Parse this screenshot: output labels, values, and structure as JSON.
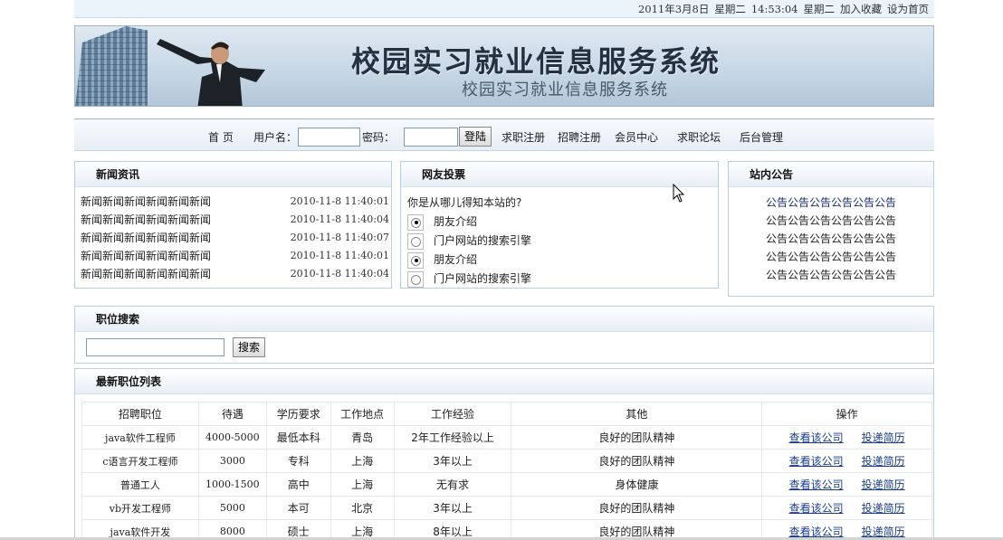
{
  "topbar": {
    "date": "2011年3月8日",
    "weekday": "星期二",
    "time": "14:53:04",
    "weekday2": "星期二",
    "add_favorite": "加入收藏",
    "set_home": "设为首页"
  },
  "banner": {
    "title": "校园实习就业信息服务系统",
    "subtitle": "校园实习就业信息服务系统"
  },
  "nav": {
    "home": "首 页",
    "username_label": "用户名：",
    "password_label": "密码：",
    "login_button": "登陆",
    "job_seeker_register": "求职注册",
    "recruit_register": "招聘注册",
    "member_center": "会员中心",
    "forum": "求职论坛",
    "admin": "后台管理"
  },
  "news": {
    "title": "新闻资讯",
    "items": [
      {
        "text": "新闻新闻新闻新闻新闻新闻",
        "date": "2010-11-8 11:40:01"
      },
      {
        "text": "新闻新闻新闻新闻新闻新闻",
        "date": "2010-11-8 11:40:04"
      },
      {
        "text": "新闻新闻新闻新闻新闻新闻",
        "date": "2010-11-8 11:40:07"
      },
      {
        "text": "新闻新闻新闻新闻新闻新闻",
        "date": "2010-11-8 11:40:01"
      },
      {
        "text": "新闻新闻新闻新闻新闻新闻",
        "date": "2010-11-8 11:40:04"
      }
    ]
  },
  "vote": {
    "title": "网友投票",
    "question": "你是从哪儿得知本站的?",
    "options": [
      {
        "label": "朋友介绍",
        "checked": true
      },
      {
        "label": "门户网站的搜索引擎",
        "checked": false
      },
      {
        "label": "朋友介绍",
        "checked": true
      },
      {
        "label": "门户网站的搜索引擎",
        "checked": false
      }
    ]
  },
  "notice": {
    "title": "站内公告",
    "items": [
      "公告公告公告公告公告公告",
      "公告公告公告公告公告公告",
      "公告公告公告公告公告公告",
      "公告公告公告公告公告公告",
      "公告公告公告公告公告公告"
    ]
  },
  "job_search": {
    "title": "职位搜索",
    "button": "搜索"
  },
  "job_list": {
    "title": "最新职位列表",
    "headers": [
      "招聘职位",
      "待遇",
      "学历要求",
      "工作地点",
      "工作经验",
      "其他",
      "操作"
    ],
    "rows": [
      [
        "java软件工程师",
        "4000-5000",
        "最低本科",
        "青岛",
        "2年工作经验以上",
        "良好的团队精神"
      ],
      [
        "c语言开发工程师",
        "3000",
        "专科",
        "上海",
        "3年以上",
        "良好的团队精神"
      ],
      [
        "普通工人",
        "1000-1500",
        "高中",
        "上海",
        "无有求",
        "身体健康"
      ],
      [
        "vb开发工程师",
        "5000",
        "本可",
        "北京",
        "3年以上",
        "良好的团队精神"
      ],
      [
        "java软件开发",
        "8000",
        "硕士",
        "上海",
        "8年以上",
        "良好的团队精神"
      ]
    ],
    "view_company": "查看该公司",
    "submit_resume": "投递简历"
  }
}
